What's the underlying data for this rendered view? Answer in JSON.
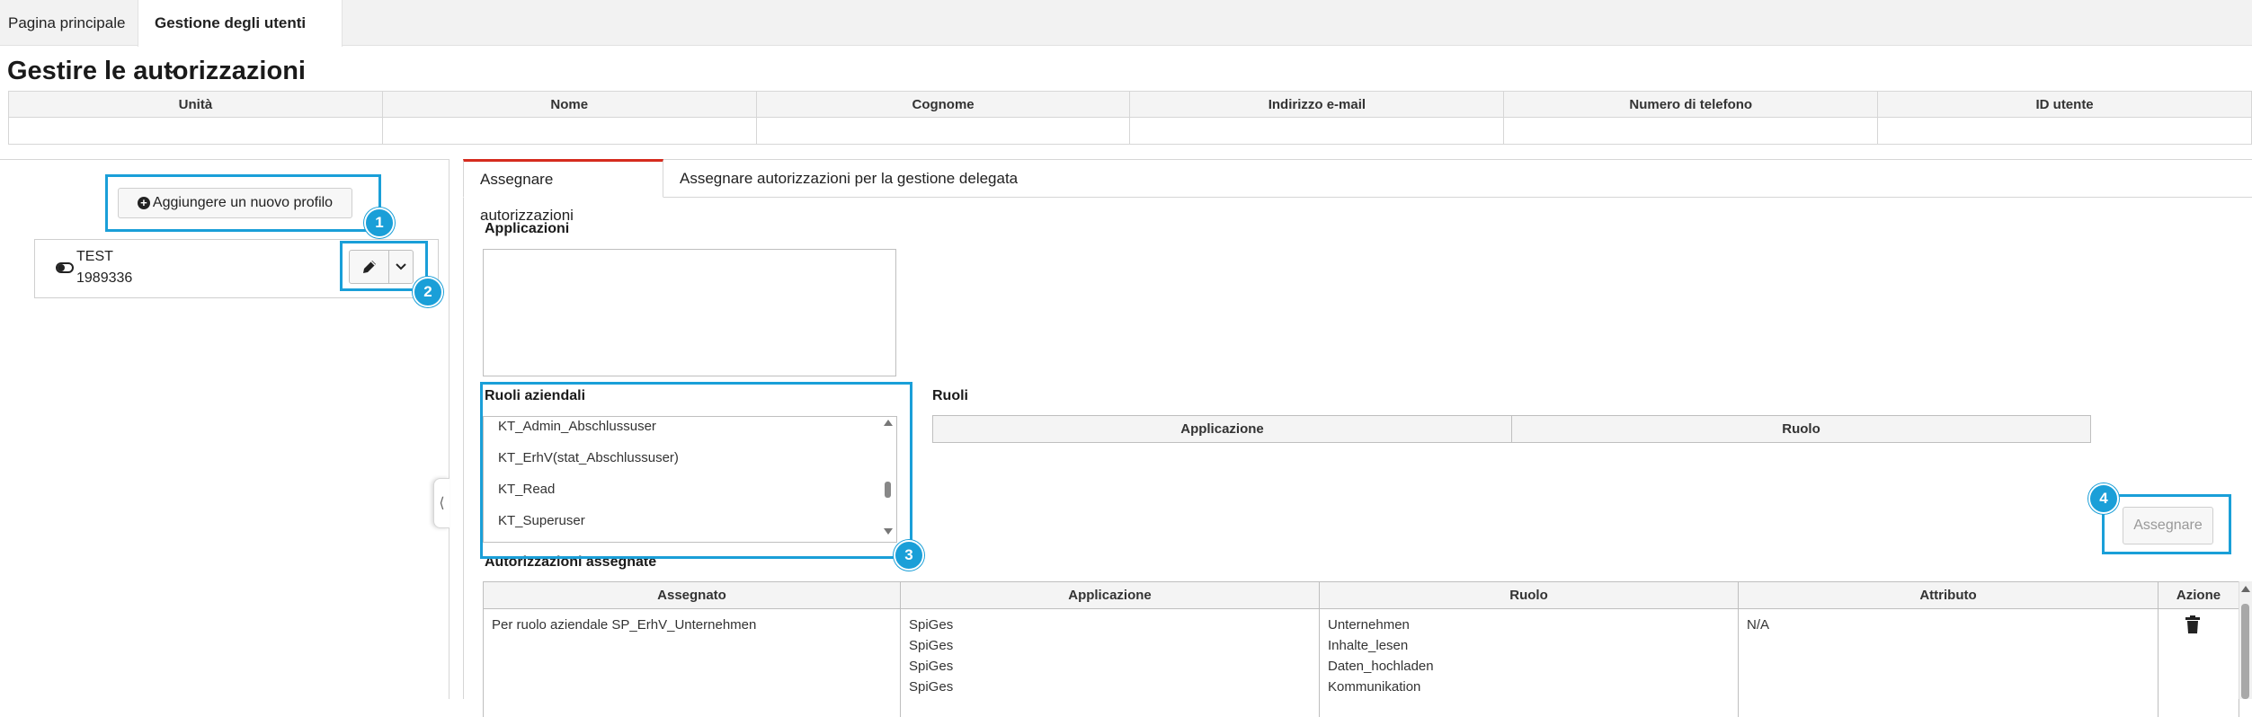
{
  "top_tabs": [
    {
      "label": "Pagina principale"
    },
    {
      "label": "Gestione degli utenti"
    }
  ],
  "page_title": "Gestire le autorizzazioni",
  "user_table": {
    "headers": [
      "Unità",
      "Nome",
      "Cognome",
      "Indirizzo e-mail",
      "Numero di telefono",
      "ID utente"
    ]
  },
  "left_panel": {
    "add_profile_label": "Aggiungere un nuovo profilo",
    "profile": {
      "name": "TEST",
      "id": "1989336"
    }
  },
  "right_tabs": [
    {
      "label": "Assegnare autorizzazioni"
    },
    {
      "label": "Assegnare autorizzazioni per la gestione delegata"
    }
  ],
  "applications_label": "Applicazioni",
  "business_roles": {
    "label": "Ruoli aziendali",
    "items": [
      "KT_Admin_Abschlussuser",
      "KT_ErhV(stat_Abschlussuser)",
      "KT_Read",
      "KT_Superuser"
    ]
  },
  "roles": {
    "label": "Ruoli",
    "headers": [
      "Applicazione",
      "Ruolo"
    ]
  },
  "assign_button_label": "Assegnare",
  "assigned": {
    "label": "Autorizzazioni assegnate",
    "headers": [
      "Assegnato",
      "Applicazione",
      "Ruolo",
      "Attributo",
      "Azione"
    ],
    "row": {
      "assigned": "Per ruolo aziendale SP_ErhV_Unternehmen",
      "applications": [
        "SpiGes",
        "SpiGes",
        "SpiGes",
        "SpiGes"
      ],
      "roles": [
        "Unternehmen",
        "Inhalte_lesen",
        "Daten_hochladen",
        "Kommunikation"
      ],
      "attribute": "N/A"
    }
  },
  "callouts": [
    "1",
    "2",
    "3",
    "4"
  ],
  "colors": {
    "accent": "#1a9fd8",
    "active_tab": "#d52b1e"
  },
  "icons": [
    "plus-circle-icon",
    "toggle-icon",
    "pencil-icon",
    "chevron-down-icon",
    "trash-icon",
    "chevron-left-icon"
  ]
}
